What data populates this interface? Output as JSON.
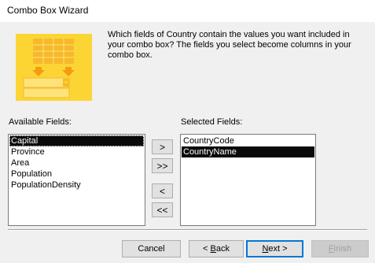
{
  "window": {
    "title": "Combo Box Wizard"
  },
  "prompt": "Which fields of Country contain the values you want included in your combo box? The fields you select become columns in your combo box.",
  "available": {
    "label": "Available Fields:",
    "items": [
      "Capital",
      "Province",
      "Area",
      "Population",
      "PopulationDensity"
    ]
  },
  "selected": {
    "label": "Selected Fields:",
    "items": [
      "CountryCode",
      "CountryName"
    ]
  },
  "move": {
    "add_one": ">",
    "add_all": ">>",
    "remove_one": "<",
    "remove_all": "<<"
  },
  "footer": {
    "cancel": "Cancel",
    "back_prefix": "< ",
    "back_hotkey": "B",
    "back_rest": "ack",
    "next_hotkey": "N",
    "next_rest": "ext >",
    "finish_hotkey": "F",
    "finish_rest": "inish"
  },
  "colors": {
    "illustration_bg": "#fcd534",
    "illustration_grid": "#f7b929",
    "illustration_arrow": "#f39c12",
    "selection": "#0a0a0a",
    "default_button_border": "#0078d7"
  }
}
